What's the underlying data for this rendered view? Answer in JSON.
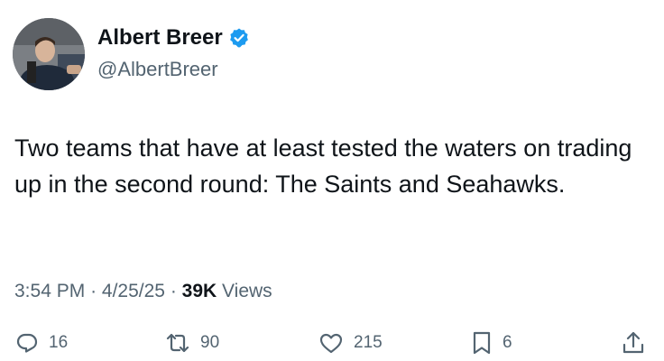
{
  "author": {
    "display_name": "Albert Breer",
    "handle": "@AlbertBreer",
    "verified": true,
    "verified_color": "#1d9bf0"
  },
  "tweet": {
    "text": "Two teams that have at least tested the waters on trading up in the second round: The Saints and Seahawks."
  },
  "meta": {
    "time": "3:54 PM",
    "separator": "·",
    "date": "4/25/25",
    "views_count": "39K",
    "views_label": "Views"
  },
  "actions": {
    "replies": "16",
    "reposts": "90",
    "likes": "215",
    "bookmarks": "6"
  },
  "icons": [
    "verified-badge-icon",
    "reply-icon",
    "retweet-icon",
    "like-icon",
    "bookmark-icon",
    "share-icon"
  ],
  "colors": {
    "text_primary": "#0f1419",
    "text_secondary": "#536471",
    "accent": "#1d9bf0"
  }
}
